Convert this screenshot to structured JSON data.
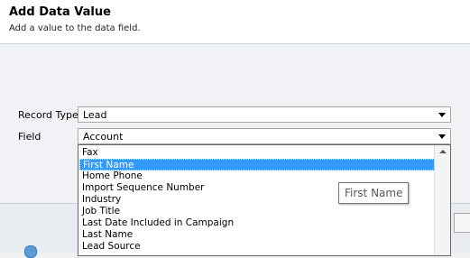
{
  "dialog": {
    "title": "Add Data Value",
    "subtitle": "Add a value to the data field."
  },
  "form": {
    "record_type_label": "Record Type",
    "record_type_value": "Lead",
    "field_label": "Field",
    "field_value": "Account"
  },
  "dropdown": {
    "options": [
      "Fax",
      "First Name",
      "Home Phone",
      "Import Sequence Number",
      "Industry",
      "Job Title",
      "Last Date Included in Campaign",
      "Last Name",
      "Lead Source"
    ],
    "selected_index": 1
  },
  "tooltip": {
    "text": "First Name"
  },
  "colors": {
    "selection": "#3399ff",
    "header_bg": "#ffffff"
  }
}
